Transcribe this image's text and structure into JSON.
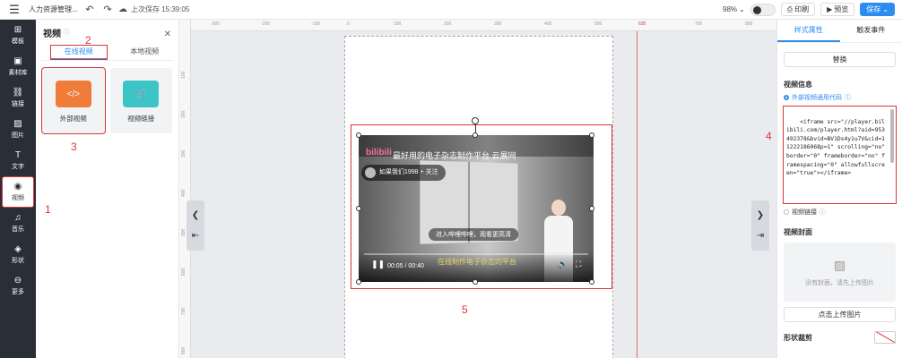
{
  "topbar": {
    "doc_title": "人力资源管理...",
    "save_status": "上次保存 15:39:05",
    "zoom": "98%",
    "print_label": "印刷",
    "preview_label": "预览",
    "save_label": "保存"
  },
  "rail": {
    "items": [
      {
        "label": "模板",
        "icon": "⊞"
      },
      {
        "label": "素材库",
        "icon": "▣"
      },
      {
        "label": "链接",
        "icon": "⛓"
      },
      {
        "label": "图片",
        "icon": "▨"
      },
      {
        "label": "文字",
        "icon": "T"
      },
      {
        "label": "视频",
        "icon": "◉"
      },
      {
        "label": "音乐",
        "icon": "♫"
      },
      {
        "label": "形状",
        "icon": "◈"
      },
      {
        "label": "更多",
        "icon": "⊖"
      }
    ]
  },
  "panel": {
    "title": "视频",
    "tabs": [
      "在线视频",
      "本地视频"
    ],
    "cards": [
      {
        "label": "外部视频",
        "icon": "</>",
        "color": "#f07c3a"
      },
      {
        "label": "视频链接",
        "icon": "🔗",
        "color": "#3cc4c6"
      }
    ]
  },
  "annotations": [
    "1",
    "2",
    "3",
    "4",
    "5"
  ],
  "ruler": {
    "top_ticks": [
      "-300",
      "-200",
      "-100",
      "0",
      "100",
      "200",
      "300",
      "400",
      "500",
      "635",
      "700",
      "800"
    ],
    "left_ticks": [
      "100",
      "200",
      "300",
      "400",
      "500",
      "600",
      "700",
      "800"
    ]
  },
  "video": {
    "logo": "bilibili",
    "title": "最好用的电子杂志制作平台 云展网",
    "uploader": "如果我们1998",
    "follow": "+ 关注",
    "toast": "进入哔哩哔哩，观看更高清",
    "time": "00:05 / 00:40",
    "subtitle": "在线制作电子杂志的平台"
  },
  "rpanel": {
    "tabs": [
      "样式属性",
      "触发事件"
    ],
    "replace_label": "替换",
    "video_info_label": "视频信息",
    "option_embed": "外部视频通用代码",
    "embed_code": "<iframe src=\"//player.bilibili.com/player.html?aid=953492378&bvid=BV1Ds4y1u7V&cid=11222186068p=1\" scrolling=\"no\" border=\"0\" frameborder=\"no\" framespacing=\"0\" allowfullscreen=\"true\"></iframe>",
    "option_link": "视频链接",
    "cover_label": "视频封面",
    "cover_placeholder": "没有封面，请先上传图片",
    "upload_label": "点击上传图片",
    "shape_crop_label": "形状裁剪"
  },
  "colors": {
    "accent": "#2d8cf0",
    "annotation": "#d93636",
    "rail_bg": "#2a2e36"
  }
}
